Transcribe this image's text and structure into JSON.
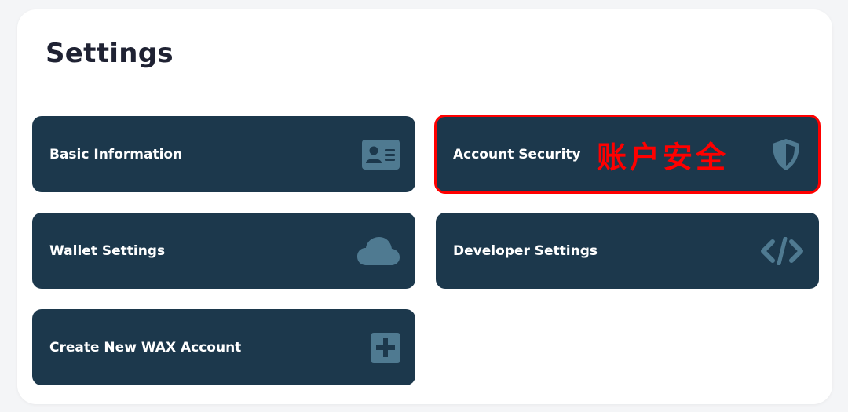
{
  "page": {
    "title": "Settings"
  },
  "colors": {
    "card_background": "#1c384c",
    "icon_color": "#4f7a91",
    "highlight": "#ff0000",
    "title_color": "#1f2233"
  },
  "cards": [
    {
      "label": "Basic Information",
      "icon": "id-card-icon"
    },
    {
      "label": "Account Security",
      "icon": "shield-icon",
      "annotation": "账户安全",
      "highlighted": true
    },
    {
      "label": "Wallet Settings",
      "icon": "cloud-icon"
    },
    {
      "label": "Developer Settings",
      "icon": "code-icon"
    },
    {
      "label": "Create New WAX Account",
      "icon": "plus-square-icon"
    }
  ]
}
